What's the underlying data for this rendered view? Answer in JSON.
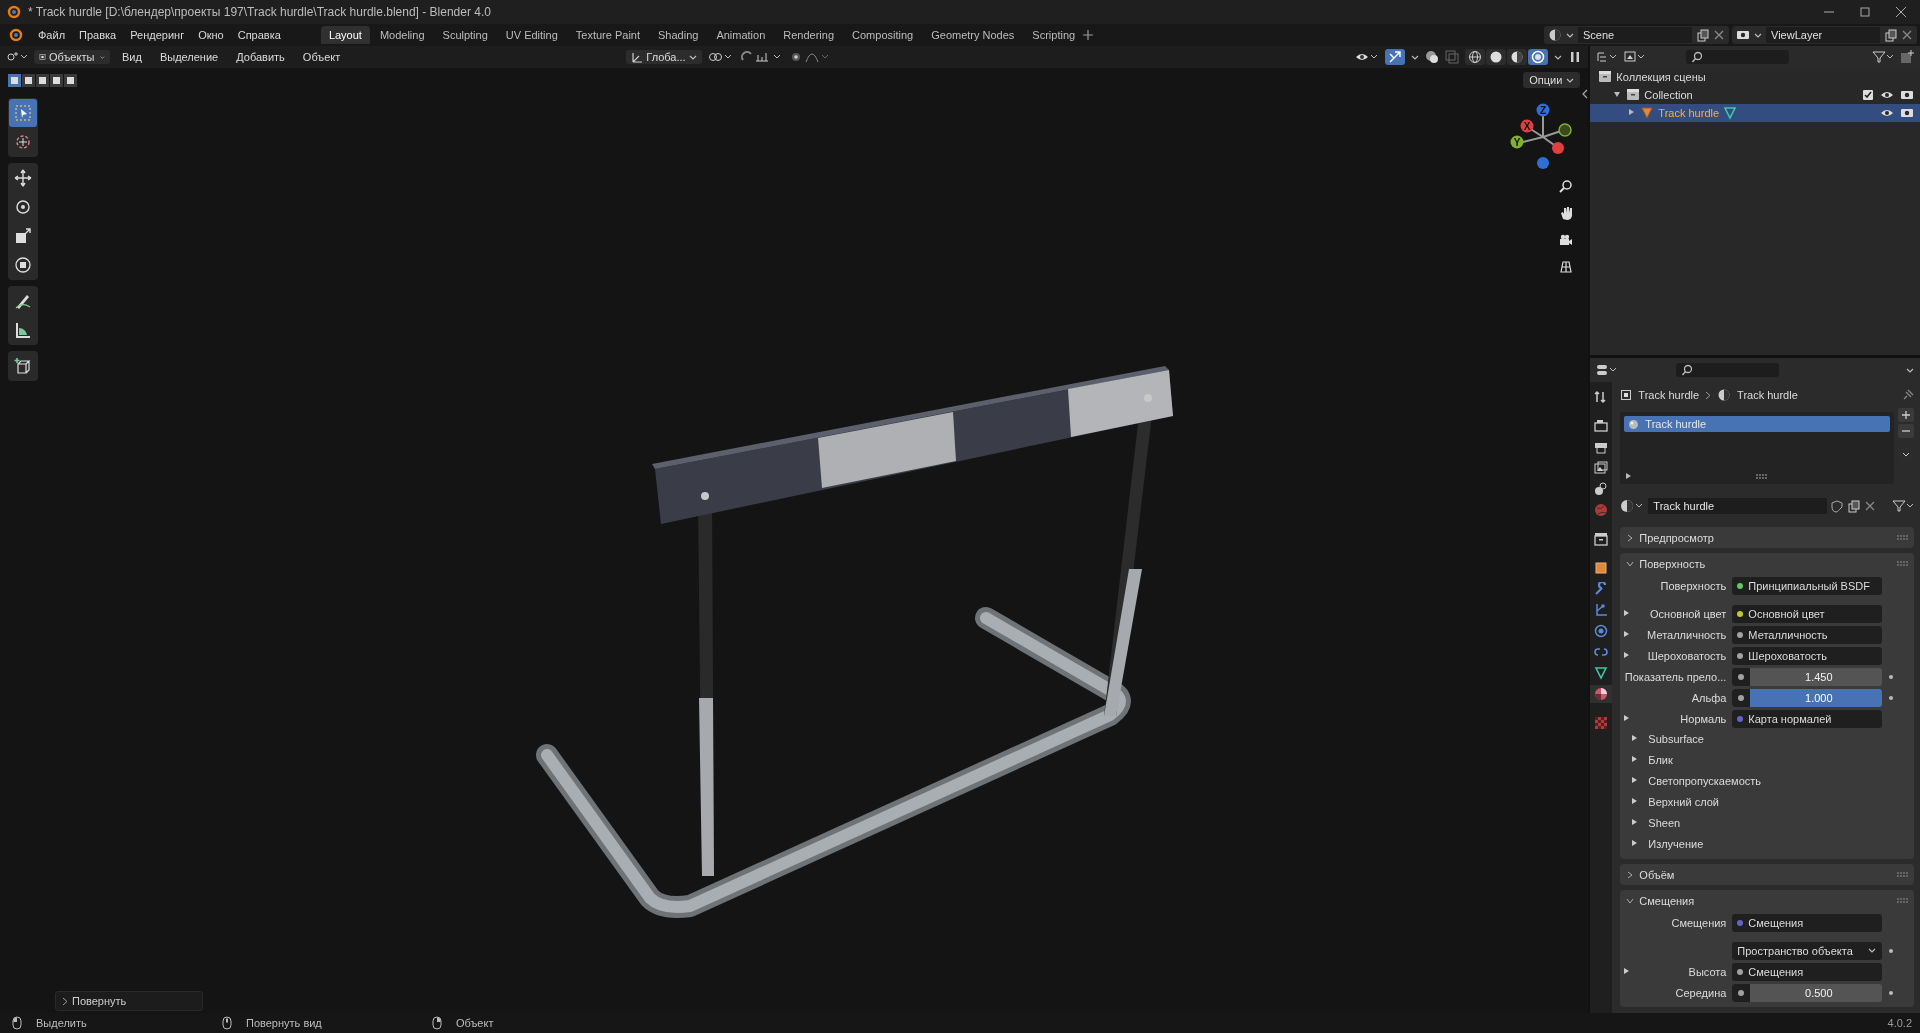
{
  "window": {
    "title": "* Track hurdle [D:\\блендер\\проекты 197\\Track hurdle\\Track hurdle.blend] - Blender 4.0"
  },
  "menu": [
    "Файл",
    "Правка",
    "Рендеринг",
    "Окно",
    "Справка"
  ],
  "workspaces": [
    {
      "label": "Layout",
      "selected": true
    },
    {
      "label": "Modeling",
      "selected": false
    },
    {
      "label": "Sculpting",
      "selected": false
    },
    {
      "label": "UV Editing",
      "selected": false
    },
    {
      "label": "Texture Paint",
      "selected": false
    },
    {
      "label": "Shading",
      "selected": false
    },
    {
      "label": "Animation",
      "selected": false
    },
    {
      "label": "Rendering",
      "selected": false
    },
    {
      "label": "Compositing",
      "selected": false
    },
    {
      "label": "Geometry Nodes",
      "selected": false
    },
    {
      "label": "Scripting",
      "selected": false
    }
  ],
  "scene": "Scene",
  "view_layer": "ViewLayer",
  "viewport": {
    "mode": "Объекты",
    "menus": [
      "Вид",
      "Выделение",
      "Добавить",
      "Объект"
    ],
    "orientation": "Глоба...",
    "select_modes": [
      {
        "selected": true
      },
      {
        "selected": false
      },
      {
        "selected": false
      },
      {
        "selected": false
      },
      {
        "selected": false
      }
    ],
    "shading": [
      {
        "selected": false
      },
      {
        "selected": false
      },
      {
        "selected": false
      },
      {
        "selected": true
      }
    ],
    "options": "Опции",
    "axes": [
      "Z",
      "X",
      "Y"
    ],
    "tools": [
      {
        "selected": true
      },
      {
        "selected": false
      },
      {
        "selected": false
      },
      {
        "selected": false
      },
      {
        "selected": false
      },
      {
        "selected": false
      },
      {
        "selected": false
      },
      {
        "selected": false
      },
      {
        "selected": false
      }
    ],
    "last_operator": "Повернуть"
  },
  "outliner": {
    "items": [
      {
        "label": "Коллекция сцены",
        "children": [
          {
            "label": "Collection",
            "expanded": true,
            "checked": true,
            "children": [
              {
                "label": "Track hurdle",
                "selected": true,
                "expanded": false
              }
            ]
          }
        ]
      }
    ]
  },
  "properties": {
    "tabs": [
      {
        "selected": false
      },
      {
        "selected": false
      },
      {
        "selected": false
      },
      {
        "selected": false
      },
      {
        "selected": false
      },
      {
        "selected": false
      },
      {
        "selected": false
      },
      {
        "selected": false
      },
      {
        "selected": false
      },
      {
        "selected": false
      },
      {
        "selected": false
      },
      {
        "selected": false
      },
      {
        "selected": false
      },
      {
        "selected": true
      },
      {
        "selected": false
      }
    ],
    "breadcrumb": [
      "Track hurdle",
      "Track hurdle"
    ],
    "slots": [
      {
        "name": "Track hurdle",
        "selected": true
      }
    ],
    "material": "Track hurdle",
    "panels": [
      {
        "title": "Предпросмотр",
        "expanded": false
      },
      {
        "title": "Поверхность",
        "expanded": true,
        "rows": [
          {
            "kind": "socket",
            "label": "Поверхность",
            "color": "#63c763",
            "value": "Принципиальный BSDF",
            "expandable": false
          },
          {
            "kind": "socket",
            "label": "Основной цвет",
            "color": "#c7c729",
            "value": "Основной цвет",
            "expandable": true
          },
          {
            "kind": "socket",
            "label": "Металличность",
            "color": "#a1a1a1",
            "value": "Металличность",
            "expandable": true
          },
          {
            "kind": "socket",
            "label": "Шероховатость",
            "color": "#a1a1a1",
            "value": "Шероховатость",
            "expandable": true
          },
          {
            "kind": "number",
            "label": "Показатель прело...",
            "color": "#a1a1a1",
            "value": "1.450",
            "highlighted": false
          },
          {
            "kind": "number",
            "label": "Альфа",
            "color": "#a1a1a1",
            "value": "1.000",
            "highlighted": true
          },
          {
            "kind": "socket",
            "label": "Нормаль",
            "color": "#6363c7",
            "value": "Карта нормалей",
            "expandable": true
          },
          {
            "kind": "sub",
            "label": "Subsurface"
          },
          {
            "kind": "sub",
            "label": "Блик"
          },
          {
            "kind": "sub",
            "label": "Светопропускаемость"
          },
          {
            "kind": "sub",
            "label": "Верхний слой"
          },
          {
            "kind": "sub",
            "label": "Sheen"
          },
          {
            "kind": "sub",
            "label": "Излучение"
          }
        ]
      },
      {
        "title": "Объём",
        "expanded": false
      },
      {
        "title": "Смещения",
        "expanded": true,
        "rows": [
          {
            "kind": "socket",
            "label": "Смещения",
            "color": "#6363c7",
            "value": "Смещения",
            "expandable": false
          },
          {
            "kind": "dropdown",
            "value": "Пространство объекта"
          },
          {
            "kind": "socket",
            "label": "Высота",
            "color": "#a1a1a1",
            "value": "Смещения",
            "expandable": true
          },
          {
            "kind": "number",
            "label": "Середина",
            "color": "#a1a1a1",
            "value": "0.500",
            "highlighted": false
          }
        ]
      }
    ]
  },
  "status": [
    "Выделить",
    "Повернуть вид",
    "Объект"
  ],
  "version": "4.0.2"
}
